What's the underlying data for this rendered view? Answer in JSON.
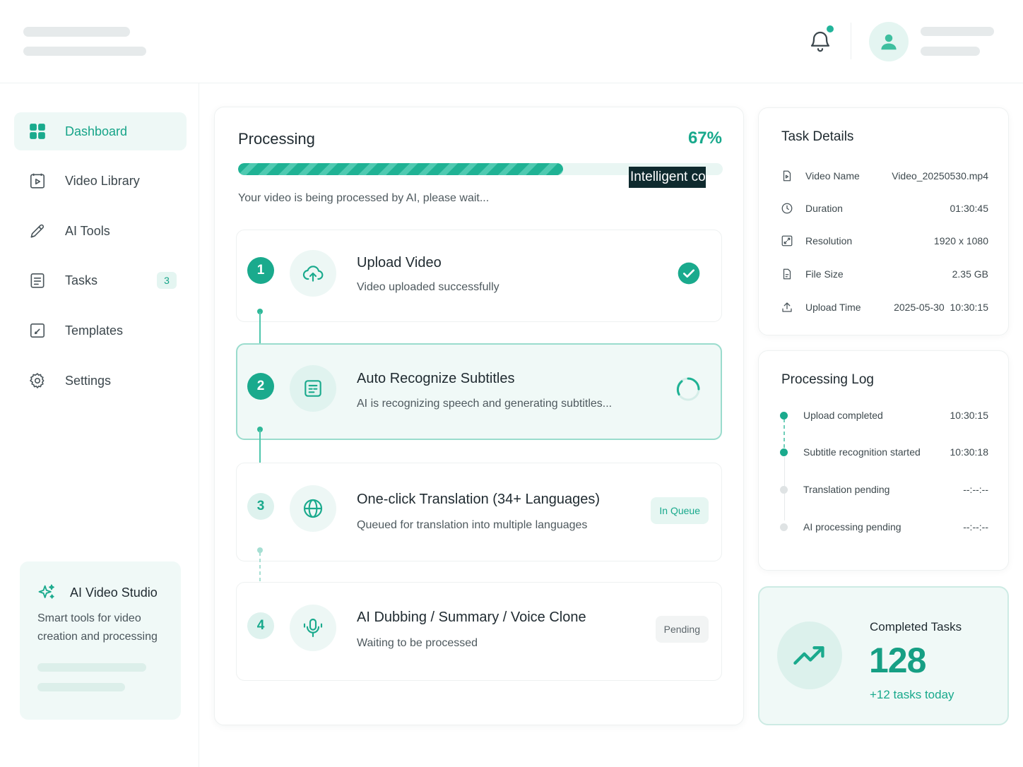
{
  "colors": {
    "accent": "#18a98c",
    "accent_light": "#e6f6f2",
    "text": "#1f2a30"
  },
  "icons": {
    "notification": "bell-icon",
    "avatar": "user-icon",
    "dashboard": "grid-icon",
    "video_library": "video-file-icon",
    "ai_tools": "pen-icon",
    "tasks": "clipboard-icon",
    "templates": "template-icon",
    "settings": "gear-icon",
    "studio": "sparkles-icon",
    "trend": "trend-up-icon"
  },
  "sidebar": {
    "items": [
      {
        "label": "Dashboard",
        "active": true
      },
      {
        "label": "Video Library"
      },
      {
        "label": "AI Tools"
      },
      {
        "label": "Tasks",
        "badge": "3"
      },
      {
        "label": "Templates"
      },
      {
        "label": "Settings"
      }
    ],
    "studio": {
      "title": "AI Video Studio",
      "description": "Smart tools for video creation and processing"
    }
  },
  "processing": {
    "title": "Processing",
    "percent_label": "67%",
    "progress": 0.67,
    "overlay_text": "Intelligent complet",
    "subtitle": "Your video is being processed by AI, please wait...",
    "steps": [
      {
        "number": "1",
        "title": "Upload Video",
        "description": "Video uploaded successfully",
        "status": "done"
      },
      {
        "number": "2",
        "title": "Auto Recognize Subtitles",
        "description": "AI is recognizing speech and generating subtitles...",
        "status": "in-progress"
      },
      {
        "number": "3",
        "title": "One-click Translation (34+ Languages)",
        "description": "Queued for translation into multiple languages",
        "status": "queued",
        "badge": "In Queue"
      },
      {
        "number": "4",
        "title": "AI Dubbing / Summary / Voice Clone",
        "description": "Waiting to be processed",
        "status": "pending",
        "badge": "Pending"
      }
    ]
  },
  "task_details": {
    "title": "Task Details",
    "rows": [
      {
        "label": "Video Name",
        "value": "Video_20250530.mp4"
      },
      {
        "label": "Duration",
        "value": "01:30:45"
      },
      {
        "label": "Resolution",
        "value": "1920 x 1080"
      },
      {
        "label": "File Size",
        "value": "2.35 GB"
      },
      {
        "label": "Upload Time",
        "value": "2025-05-30  10:30:15"
      }
    ]
  },
  "processing_log": {
    "title": "Processing Log",
    "entries": [
      {
        "label": "Upload completed",
        "time": "10:30:15",
        "state": "done"
      },
      {
        "label": "Subtitle recognition started",
        "time": "10:30:18",
        "state": "done"
      },
      {
        "label": "Translation pending",
        "time": "--:--:--",
        "state": "pending"
      },
      {
        "label": "AI processing pending",
        "time": "--:--:--",
        "state": "pending"
      }
    ]
  },
  "completed": {
    "label": "Completed Tasks",
    "value": "128",
    "delta": "+12 tasks today"
  }
}
